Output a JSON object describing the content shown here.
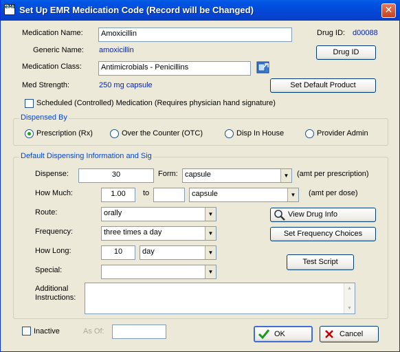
{
  "window": {
    "title": "Set Up EMR Medication Code  (Record will be Changed)",
    "icon_text": "eMD",
    "close_glyph": "✕"
  },
  "medication": {
    "name_label": "Medication Name:",
    "name_value": "Amoxicillin",
    "generic_label": "Generic Name:",
    "generic_value": "amoxicillin",
    "class_label": "Medication Class:",
    "class_value": "Antimicrobials - Penicillins",
    "strength_label": "Med Strength:",
    "strength_value": "250 mg capsule",
    "drug_id_label": "Drug ID:",
    "drug_id_value": "d00088",
    "drug_id_button": "Drug ID",
    "default_product_button": "Set Default Product",
    "scheduled_label": "Scheduled (Controlled) Medication (Requires physician hand signature)",
    "scheduled_checked": false
  },
  "dispensed_by": {
    "title": "Dispensed By",
    "options": [
      {
        "label": "Prescription (Rx)",
        "selected": true
      },
      {
        "label": "Over the Counter (OTC)",
        "selected": false
      },
      {
        "label": "Disp In House",
        "selected": false
      },
      {
        "label": "Provider Admin",
        "selected": false
      }
    ]
  },
  "sig": {
    "title": "Default Dispensing Information and Sig",
    "dispense_label": "Dispense:",
    "dispense_value": "30",
    "form_label": "Form:",
    "form_value": "capsule",
    "form_note": "(amt per prescription)",
    "how_much_label": "How Much:",
    "how_much_from": "1.00",
    "to_label": "to",
    "how_much_to": "",
    "how_much_unit": "capsule",
    "how_much_note": "(amt per dose)",
    "route_label": "Route:",
    "route_value": "orally",
    "frequency_label": "Frequency:",
    "frequency_value": "three times a day",
    "how_long_label": "How Long:",
    "how_long_value": "10",
    "how_long_unit": "day",
    "special_label": "Special:",
    "special_value": "",
    "instructions_label_1": "Additional",
    "instructions_label_2": "Instructions:",
    "instructions_value": "",
    "view_drug_info_button": "View Drug Info",
    "frequency_choices_button": "Set Frequency Choices",
    "test_script_button": "Test Script"
  },
  "footer": {
    "inactive_label": "Inactive",
    "inactive_checked": false,
    "as_of_label": "As Of:",
    "as_of_value": "",
    "ok_button": "OK",
    "cancel_button": "Cancel"
  },
  "colors": {
    "title_bar": "#0447d6",
    "accent_blue_text": "#0a24a8",
    "group_title": "#0046d5",
    "window_bg": "#ece9d8"
  },
  "icons": [
    "eMD-app-icon",
    "close-icon",
    "lookup-icon",
    "dropdown-arrow-icon",
    "magnifier-icon",
    "checkmark-icon",
    "x-icon"
  ]
}
